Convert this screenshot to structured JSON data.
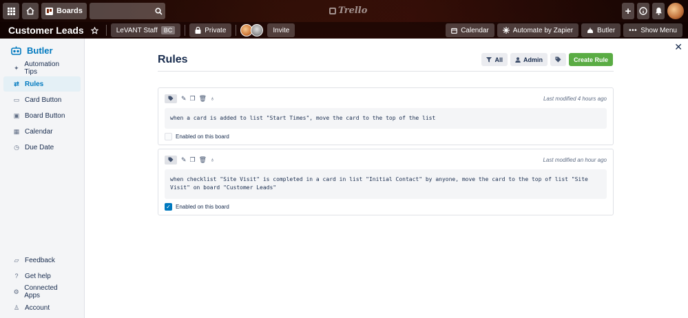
{
  "topbar": {
    "boards_label": "Boards",
    "logo_text": "Trello"
  },
  "board": {
    "title": "Customer Leads",
    "team": "LeVANT Staff",
    "team_badge": "BC",
    "visibility": "Private",
    "invite": "Invite",
    "right_buttons": [
      {
        "label": "Calendar",
        "icon": "calendar-icon"
      },
      {
        "label": "Automate by Zapier",
        "icon": "zapier-icon"
      },
      {
        "label": "Butler",
        "icon": "butler-icon"
      },
      {
        "label": "Show Menu",
        "icon": "more-icon"
      }
    ]
  },
  "sidebar": {
    "title": "Butler",
    "items": [
      {
        "label": "Automation Tips",
        "icon": "sparkle-icon",
        "active": false
      },
      {
        "label": "Rules",
        "icon": "rules-icon",
        "active": true
      },
      {
        "label": "Card Button",
        "icon": "card-button-icon",
        "active": false
      },
      {
        "label": "Board Button",
        "icon": "board-button-icon",
        "active": false
      },
      {
        "label": "Calendar",
        "icon": "calendar-icon",
        "active": false
      },
      {
        "label": "Due Date",
        "icon": "clock-icon",
        "active": false
      }
    ],
    "bottom_items": [
      {
        "label": "Feedback",
        "icon": "feedback-icon"
      },
      {
        "label": "Get help",
        "icon": "help-icon"
      },
      {
        "label": "Connected Apps",
        "icon": "gear-icon"
      },
      {
        "label": "Account",
        "icon": "account-icon"
      }
    ]
  },
  "main": {
    "title": "Rules",
    "actions": {
      "all": "All",
      "admin": "Admin",
      "create": "Create Rule"
    },
    "rules": [
      {
        "text": "when a card is added to list \"Start Times\", move the card to the top of the list",
        "modified": "Last modified 4 hours ago",
        "enabled_label": "Enabled on this board",
        "enabled": false
      },
      {
        "text": "when checklist \"Site Visit\" is completed in a card in list \"Initial Contact\" by anyone, move the card to the top of list \"Site Visit\" on board \"Customer Leads\"",
        "modified": "Last modified an hour ago",
        "enabled_label": "Enabled on this board",
        "enabled": true
      }
    ]
  },
  "colors": {
    "accent": "#0079bf",
    "create_button": "#5aac44"
  }
}
